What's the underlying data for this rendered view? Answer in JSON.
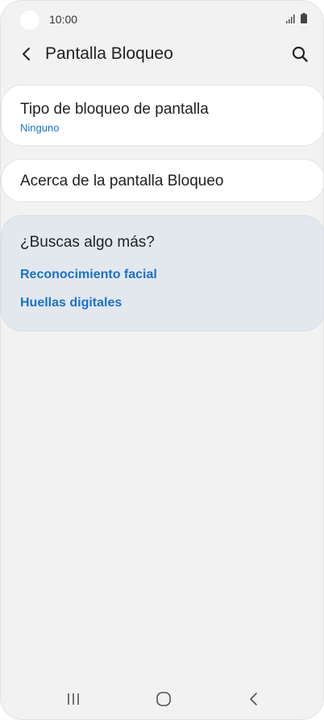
{
  "status_bar": {
    "time": "10:00"
  },
  "header": {
    "title": "Pantalla Bloqueo",
    "back_icon": "chevron-left-icon",
    "search_icon": "search-icon"
  },
  "lock_type": {
    "title": "Tipo de bloqueo de pantalla",
    "value": "Ninguno"
  },
  "about": {
    "title": "Acerca de la pantalla Bloqueo"
  },
  "suggestions": {
    "title": "¿Buscas algo más?",
    "links": [
      "Reconocimiento facial",
      "Huellas digitales"
    ]
  },
  "nav_bar": {
    "icons": [
      "recents-icon",
      "home-icon",
      "back-icon"
    ]
  },
  "colors": {
    "background": "#f2f2f2",
    "card": "#ffffff",
    "suggestion_bg": "#e3e8ef",
    "accent": "#1a73c8",
    "text": "#222222"
  }
}
